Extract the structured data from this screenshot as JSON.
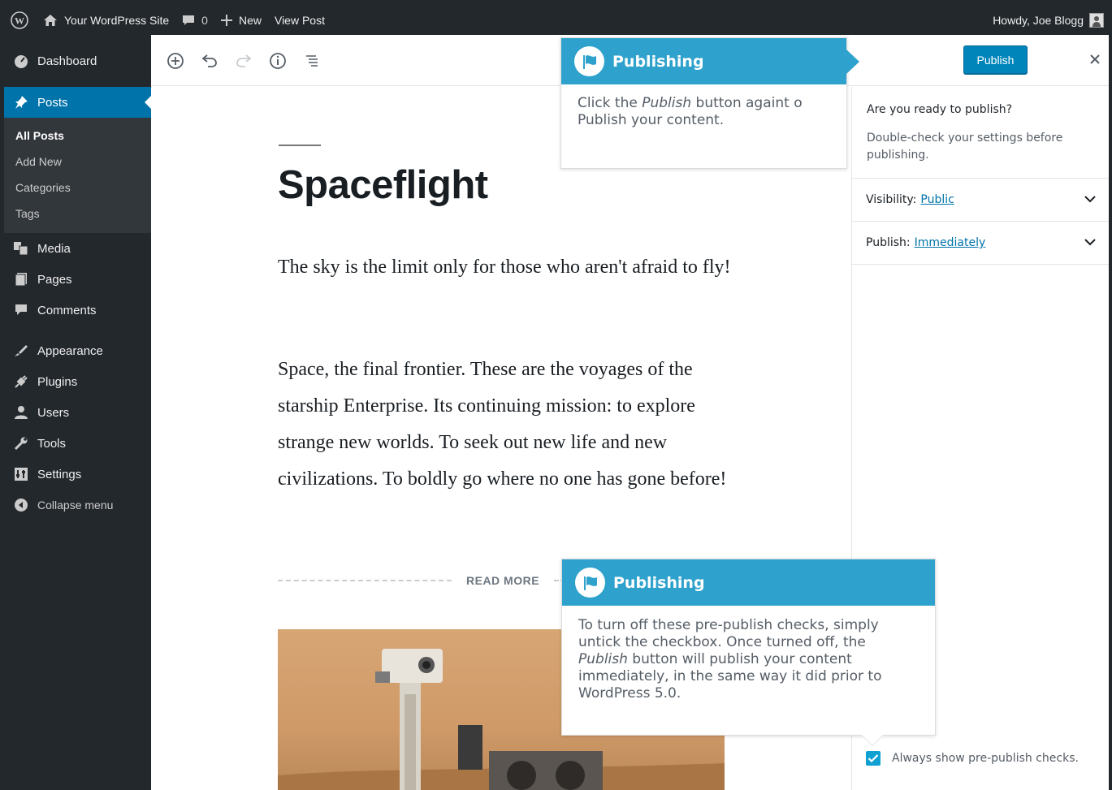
{
  "admin_bar": {
    "site_name": "Your WordPress Site",
    "comment_count": "0",
    "new_label": "New",
    "view_post_label": "View Post",
    "howdy": "Howdy, Joe Blogg"
  },
  "sidebar": {
    "items": [
      {
        "label": "Dashboard",
        "icon": "dashboard-icon"
      },
      {
        "label": "Posts",
        "icon": "pin-icon"
      },
      {
        "label": "Media",
        "icon": "media-icon"
      },
      {
        "label": "Pages",
        "icon": "pages-icon"
      },
      {
        "label": "Comments",
        "icon": "comment-icon"
      },
      {
        "label": "Appearance",
        "icon": "brush-icon"
      },
      {
        "label": "Plugins",
        "icon": "plugin-icon"
      },
      {
        "label": "Users",
        "icon": "user-icon"
      },
      {
        "label": "Tools",
        "icon": "wrench-icon"
      },
      {
        "label": "Settings",
        "icon": "settings-icon"
      },
      {
        "label": "Collapse menu",
        "icon": "collapse-icon"
      }
    ],
    "posts_submenu": [
      "All Posts",
      "Add New",
      "Categories",
      "Tags"
    ]
  },
  "toolbar": {
    "publish_label": "Publish"
  },
  "post": {
    "title": "Spaceflight",
    "paragraph1": "The sky is the limit only for those who aren't afraid to fly!",
    "paragraph2": "Space, the final frontier. These are the voyages of the starship Enterprise. Its  continuing mission: to explore strange new worlds. To seek out new life  and new civilizations. To boldly go where no one has gone before!",
    "read_more": "READ MORE"
  },
  "panel": {
    "question": "Are you ready to publish?",
    "description": "Double-check your settings before publishing.",
    "visibility_label": "Visibility:",
    "visibility_value": "Public",
    "publish_label": "Publish:",
    "publish_value": "Immediately",
    "checkbox_label": "Always show pre-publish checks."
  },
  "tooltips": {
    "tip1": {
      "title": "Publishing",
      "text_before": "Click the ",
      "text_em": "Publish",
      "text_after": " button againt o Publish your content."
    },
    "tip2": {
      "title": "Publishing",
      "text_before": "To turn off these pre-publish checks, simply untick the checkbox. Once turned off, the ",
      "text_em": "Publish",
      "text_after": " button will publish your content immediately, in the same way it did prior to WordPress 5.0."
    }
  },
  "colors": {
    "admin_dark": "#23282d",
    "accent": "#0073aa",
    "tooltip_blue": "#2ea2cc",
    "publish_button": "#0085ba"
  }
}
